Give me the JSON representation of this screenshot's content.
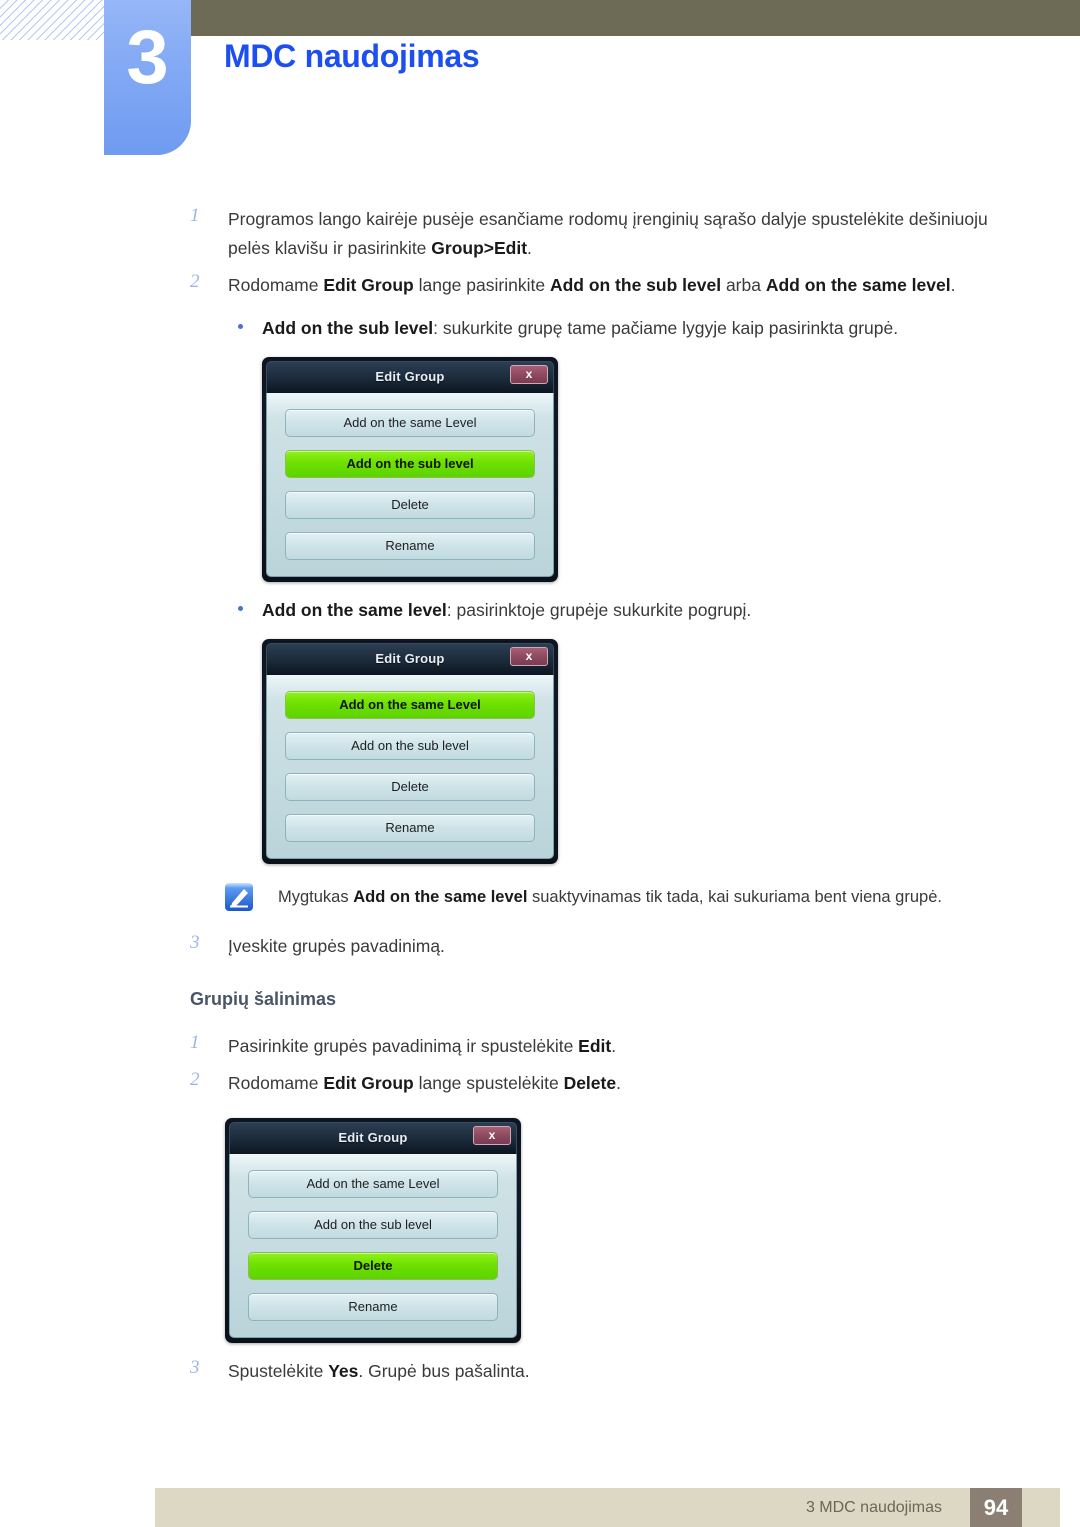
{
  "header": {
    "chapter_number": "3",
    "chapter_title": "MDC naudojimas"
  },
  "steps_top": [
    {
      "num": "1",
      "parts": [
        {
          "t": "Programos lango kairėje pusėje esančiame rodomų įrenginių sąrašo dalyje spustelėkite dešiniuoju pelės klavišu ir pasirinkite ",
          "b": false
        },
        {
          "t": "Group>Edit",
          "b": true
        },
        {
          "t": ".",
          "b": false
        }
      ]
    },
    {
      "num": "2",
      "parts": [
        {
          "t": "Rodomame ",
          "b": false
        },
        {
          "t": "Edit Group",
          "b": true
        },
        {
          "t": " lange pasirinkite ",
          "b": false
        },
        {
          "t": "Add on the sub level",
          "b": true
        },
        {
          "t": " arba ",
          "b": false
        },
        {
          "t": "Add on the same level",
          "b": true
        },
        {
          "t": ".",
          "b": false
        }
      ]
    }
  ],
  "bullet_sub": {
    "parts": [
      {
        "t": "Add on the sub level",
        "b": true
      },
      {
        "t": ": sukurkite grupę tame pačiame lygyje kaip pasirinkta grupė.",
        "b": false
      }
    ]
  },
  "bullet_same": {
    "parts": [
      {
        "t": "Add on the same level",
        "b": true
      },
      {
        "t": ": pasirinktoje grupėje sukurkite pogrupį.",
        "b": false
      }
    ]
  },
  "note": {
    "icon": "note-pen-icon",
    "parts": [
      {
        "t": "Mygtukas ",
        "b": false
      },
      {
        "t": "Add on the same level",
        "b": true
      },
      {
        "t": " suaktyvinamas tik tada, kai sukuriama bent viena grupė.",
        "b": false
      }
    ]
  },
  "step_three": {
    "num": "3",
    "parts": [
      {
        "t": "Įveskite grupės pavadinimą.",
        "b": false
      }
    ]
  },
  "section_heading": "Grupių šalinimas",
  "steps_delete": [
    {
      "num": "1",
      "parts": [
        {
          "t": "Pasirinkite grupės pavadinimą ir spustelėkite ",
          "b": false
        },
        {
          "t": "Edit",
          "b": true
        },
        {
          "t": ".",
          "b": false
        }
      ]
    },
    {
      "num": "2",
      "parts": [
        {
          "t": "Rodomame ",
          "b": false
        },
        {
          "t": "Edit Group",
          "b": true
        },
        {
          "t": " lange spustelėkite ",
          "b": false
        },
        {
          "t": "Delete",
          "b": true
        },
        {
          "t": ".",
          "b": false
        }
      ]
    }
  ],
  "step_delete_three": {
    "num": "3",
    "parts": [
      {
        "t": "Spustelėkite ",
        "b": false
      },
      {
        "t": "Yes",
        "b": true
      },
      {
        "t": ". Grupė bus pašalinta.",
        "b": false
      }
    ]
  },
  "dialogs": [
    {
      "id": "dialog-sub-level",
      "title": "Edit Group",
      "close_label": "x",
      "buttons": [
        {
          "label": "Add on the same Level",
          "active": false
        },
        {
          "label": "Add on the sub level",
          "active": true
        },
        {
          "label": "Delete",
          "active": false
        },
        {
          "label": "Rename",
          "active": false
        }
      ]
    },
    {
      "id": "dialog-same-level",
      "title": "Edit Group",
      "close_label": "x",
      "buttons": [
        {
          "label": "Add on the same Level",
          "active": true
        },
        {
          "label": "Add on the sub level",
          "active": false
        },
        {
          "label": "Delete",
          "active": false
        },
        {
          "label": "Rename",
          "active": false
        }
      ]
    },
    {
      "id": "dialog-delete",
      "title": "Edit Group",
      "close_label": "x",
      "buttons": [
        {
          "label": "Add on the same Level",
          "active": false
        },
        {
          "label": "Add on the sub level",
          "active": false
        },
        {
          "label": "Delete",
          "active": true
        },
        {
          "label": "Rename",
          "active": false
        }
      ]
    }
  ],
  "footer": {
    "label": "3 MDC naudojimas",
    "page": "94"
  },
  "colors": {
    "chapter_tab": "#82a9f4",
    "chapter_title": "#1d4ff0",
    "olive_bar": "#6d6a56",
    "footer_bar": "#ddd8c4",
    "footer_page_box": "#8a7f72",
    "active_button": "#6fe000",
    "step_number": "#9db4e8"
  }
}
